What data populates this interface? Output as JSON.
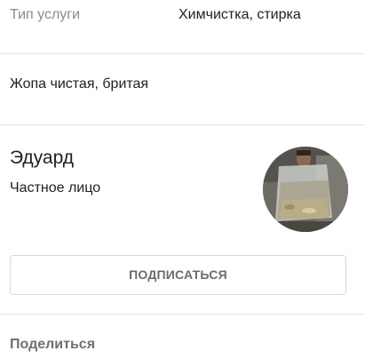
{
  "details": {
    "service_type_label": "Тип услуги",
    "service_type_value": "Химчистка, стирка"
  },
  "description": "Жопа чистая, бритая",
  "seller": {
    "name": "Эдуард",
    "type": "Частное лицо",
    "avatar_icon": "seller-avatar-photo"
  },
  "actions": {
    "subscribe_label": "ПОДПИСАТЬСЯ",
    "share_label": "Поделиться"
  },
  "colors": {
    "text_primary": "#1f1f1f",
    "text_secondary": "#8a8a8a",
    "divider": "#e6e6e6",
    "button_border": "#d9d9d9"
  }
}
